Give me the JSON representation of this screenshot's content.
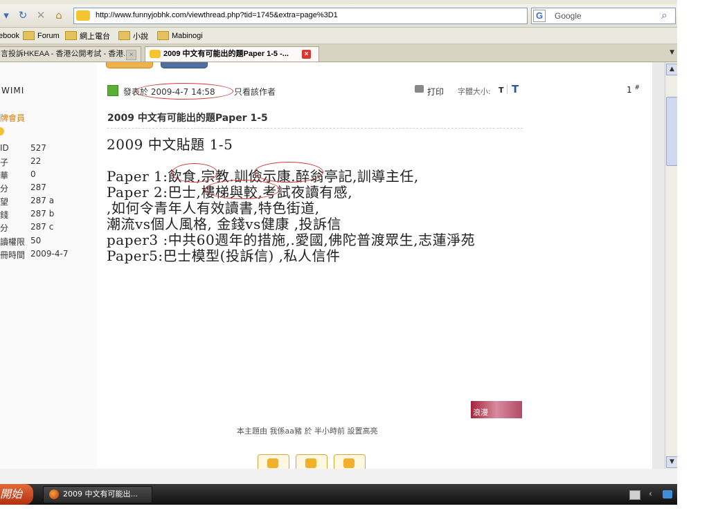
{
  "browser": {
    "url": "http://www.funnyjobhk.com/viewthread.php?tid=1745&extra=page%3D1",
    "search_placeholder": "Google",
    "search_engine_logo": "G",
    "bookmarks": [
      "ebook",
      "Forum",
      "網上電台",
      "小說",
      "Mabinogi"
    ],
    "tabs": [
      {
        "label": "言投訴HKEAA - 香港公開考試 - 香港...",
        "active": false
      },
      {
        "label": "2009 中文有可能出的題Paper 1-5 -...",
        "active": true
      }
    ]
  },
  "profile": {
    "username": "WIMI",
    "rank": "牌會員",
    "stats": [
      {
        "label": "ID",
        "value": "527"
      },
      {
        "label": "子",
        "value": "22"
      },
      {
        "label": "華",
        "value": "0"
      },
      {
        "label": "分",
        "value": "287"
      },
      {
        "label": "望",
        "value": "287 a"
      },
      {
        "label": "錢",
        "value": "287 b"
      },
      {
        "label": "分",
        "value": "287 c"
      },
      {
        "label": "讀權限",
        "value": "50"
      },
      {
        "label": "冊時間",
        "value": "2009-4-7"
      }
    ]
  },
  "post": {
    "posted_label": "發表於 2009-4-7 14:58",
    "only_author": "只看該作者",
    "print_label": "打印",
    "font_size_label": "字體大小:",
    "font_small": "T",
    "font_big": "T",
    "floor": "1",
    "floor_mark": "#",
    "title": "2009 中文有可能出的題Paper 1-5",
    "body": {
      "heading": "2009  中文貼題  1-5",
      "line1": "Paper 1:飲食,宗教.訓儉示康.醉翁亭記,訓導主任,",
      "line2": "Paper 2:巴士,樓梯與較,考試夜讀有感,",
      "line3": ",如何令青年人有效讀書,特色街道,",
      "line4": "潮流vs個人風格,  金錢vs健康  ,投訴信",
      "line5": "paper3  :中共60週年的措施,.愛國,佛陀普渡眾生,志蓮淨苑",
      "line6": "Paper5:巴士模型(投訴信)  ,私人信件"
    },
    "signature_label": "浪漫",
    "highlight_note": "本主題由 我係aa豬 於 半小時前 設置高亮"
  },
  "taskbar": {
    "start_label": "開始",
    "window_label": "2009 中文有可能出..."
  },
  "colors": {
    "annotation_red": "#d23a3a",
    "rank_orange": "#e07a00",
    "link_blue": "#235a9e",
    "taskbar_dark": "#1c1c1c"
  }
}
